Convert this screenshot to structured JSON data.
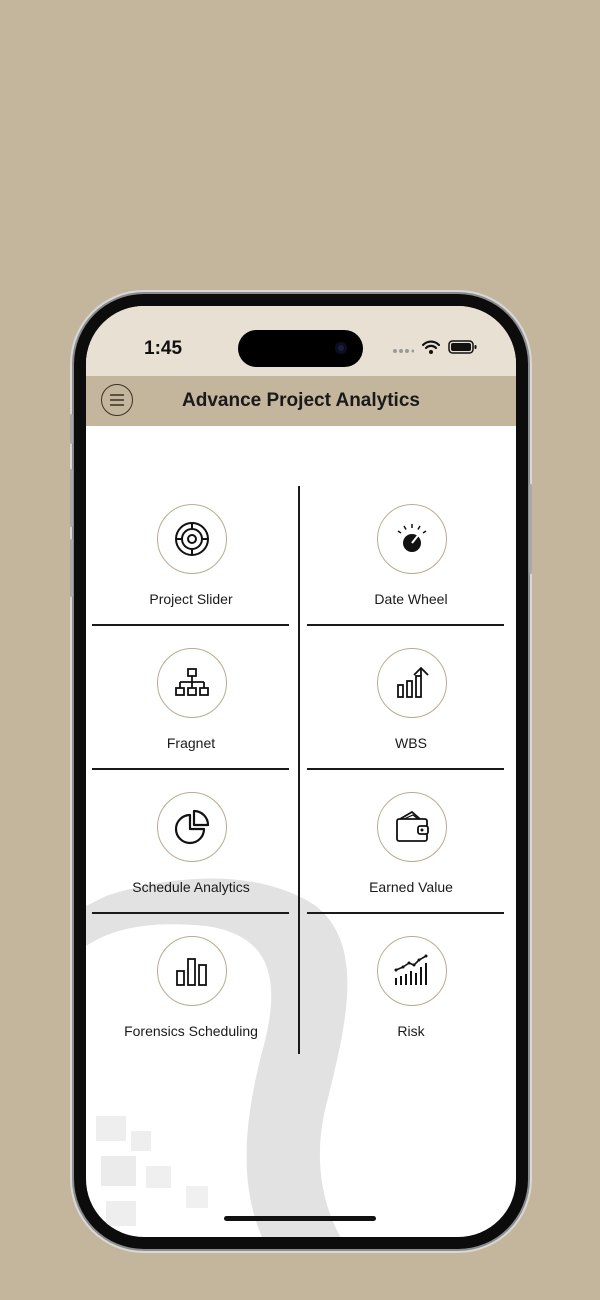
{
  "status_bar": {
    "time": "1:45"
  },
  "header": {
    "title": "Advance Project Analytics",
    "menu_icon": "hamburger-menu-icon"
  },
  "tiles": [
    {
      "label": "Project Slider",
      "icon": "target-slider-icon"
    },
    {
      "label": "Date Wheel",
      "icon": "gauge-dial-icon"
    },
    {
      "label": "Fragnet",
      "icon": "hierarchy-icon"
    },
    {
      "label": "WBS",
      "icon": "growth-bars-arrow-icon"
    },
    {
      "label": "Schedule Analytics",
      "icon": "pie-chart-icon"
    },
    {
      "label": "Earned Value",
      "icon": "wallet-icon"
    },
    {
      "label": "Forensics Scheduling",
      "icon": "bar-chart-icon"
    },
    {
      "label": "Risk",
      "icon": "trend-chart-icon"
    }
  ],
  "colors": {
    "background": "#c4b69c",
    "header": "#c4b69c",
    "status_bar": "#e8e0d2",
    "tile_border": "#b8ab93"
  }
}
